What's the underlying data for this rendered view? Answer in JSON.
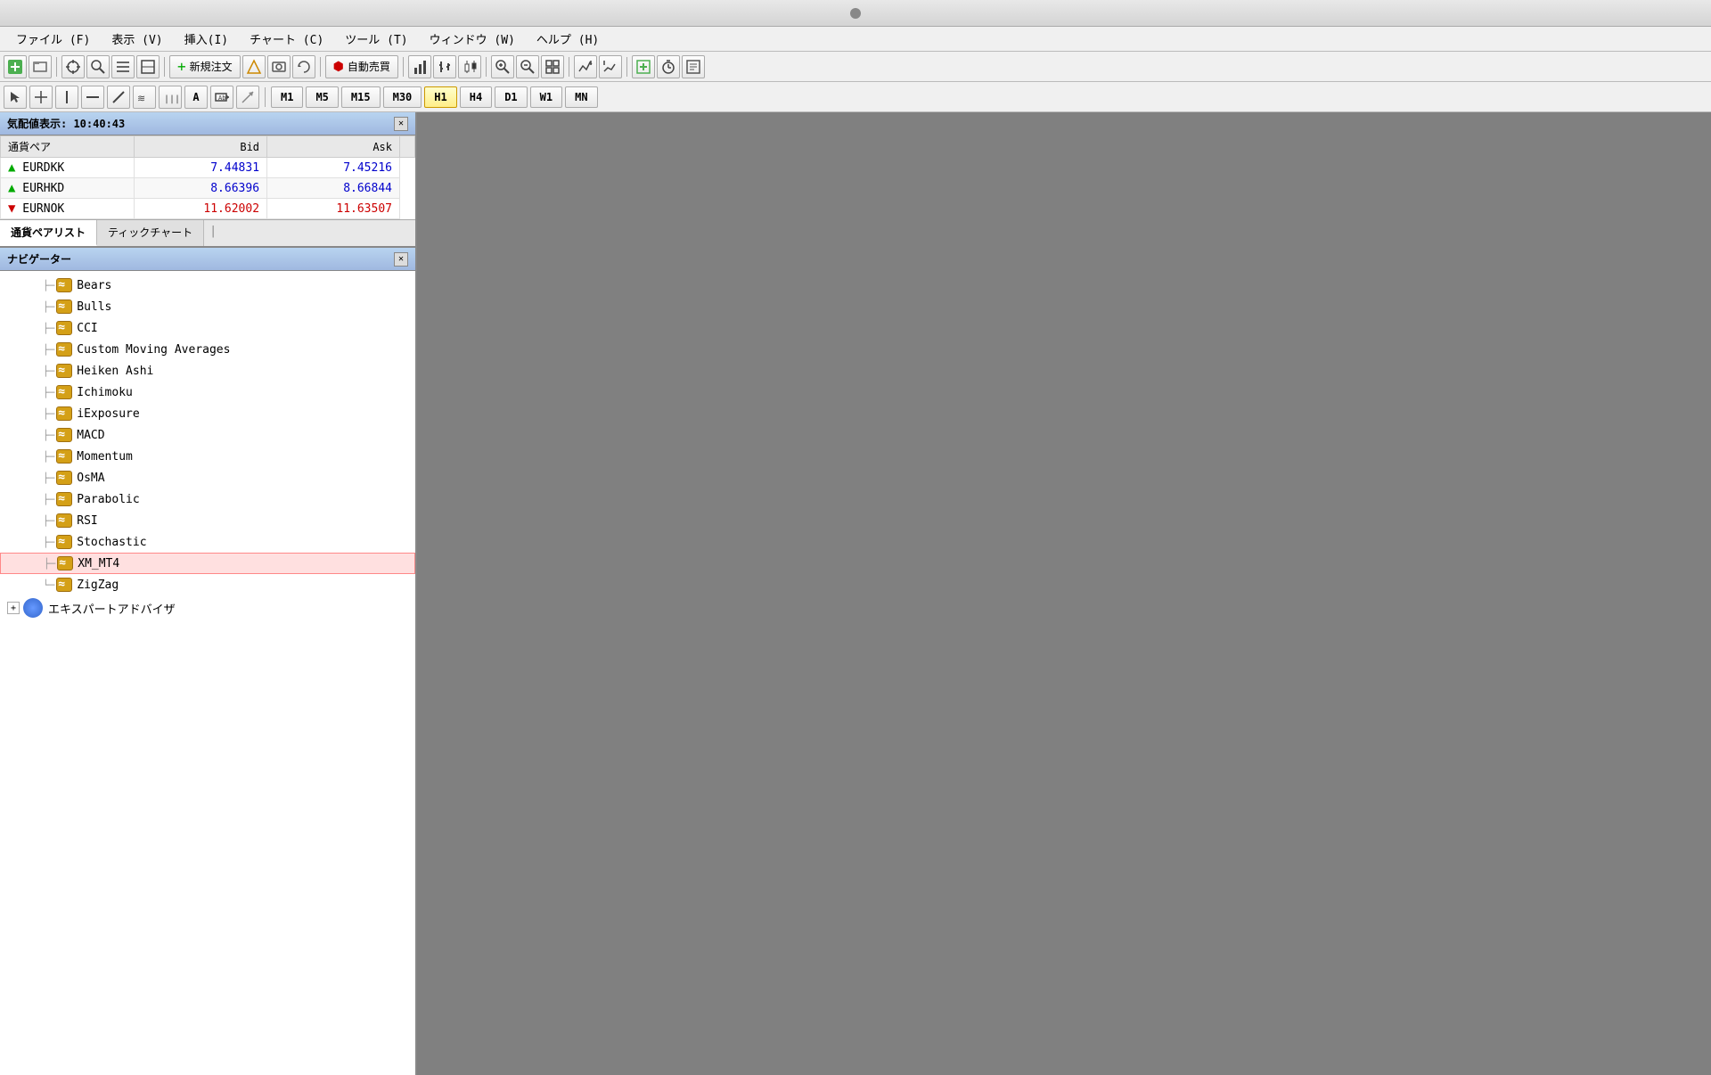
{
  "titleBar": {
    "dot": "●"
  },
  "menuBar": {
    "items": [
      "ファイル (F)",
      "表示 (V)",
      "挿入(I)",
      "チャート (C)",
      "ツール (T)",
      "ウィンドウ (W)",
      "ヘルプ (H)"
    ]
  },
  "toolbar1": {
    "newOrder": "新規注文",
    "autoTrade": "自動売買",
    "timeframes": [
      "M1",
      "M5",
      "M15",
      "M30",
      "H1",
      "H4",
      "D1",
      "W1",
      "MN"
    ],
    "activeTimeframe": "H1"
  },
  "marketWatch": {
    "title": "気配値表示: 10:40:43",
    "headers": [
      "通貨ペア",
      "Bid",
      "Ask"
    ],
    "rows": [
      {
        "pair": "EURDKK",
        "bid": "7.44831",
        "ask": "7.45216",
        "direction": "up"
      },
      {
        "pair": "EURHKD",
        "bid": "8.66396",
        "ask": "8.66844",
        "direction": "up"
      },
      {
        "pair": "EURNOK",
        "bid": "11.62002",
        "ask": "11.63507",
        "direction": "down"
      }
    ],
    "tabs": [
      "通貨ペアリスト",
      "ティックチャート"
    ]
  },
  "navigator": {
    "title": "ナビゲーター",
    "indicators": [
      "Bears",
      "Bulls",
      "CCI",
      "Custom Moving Averages",
      "Heiken Ashi",
      "Ichimoku",
      "iExposure",
      "MACD",
      "Momentum",
      "OsMA",
      "Parabolic",
      "RSI",
      "Stochastic",
      "XM_MT4",
      "ZigZag"
    ],
    "expertAdvisor": "エキスパートアドバイザ",
    "highlighted": "XM_MT4"
  }
}
